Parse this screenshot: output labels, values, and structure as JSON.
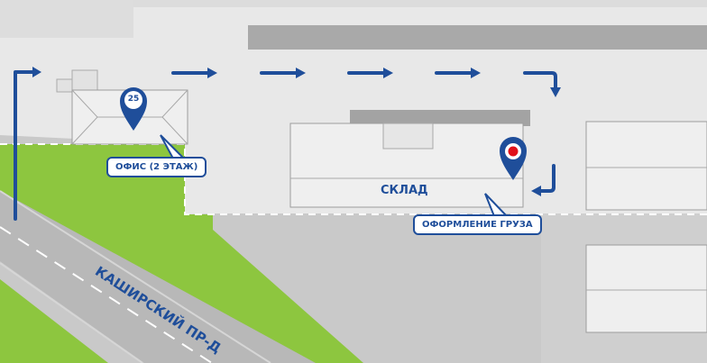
{
  "map": {
    "road_name": "КАШИРСКИЙ ПР-Д",
    "warehouse_label": "СКЛАД",
    "office_label": "ОФИС (2 ЭТАЖ)",
    "cargo_label": "ОФОРМЛЕНИЕ ГРУЗА",
    "office_pin_number": "25",
    "colors": {
      "accent": "#1f4e9a",
      "grass": "#8dc63f",
      "road": "#b8b8b8",
      "lot": "#e8e8e8",
      "building": "#eeeeee",
      "pin_marker_red": "#e0111a"
    },
    "icons": {
      "office_pin": "map-pin-icon",
      "warehouse_pin": "map-pin-icon",
      "route": "arrow-icon"
    }
  }
}
